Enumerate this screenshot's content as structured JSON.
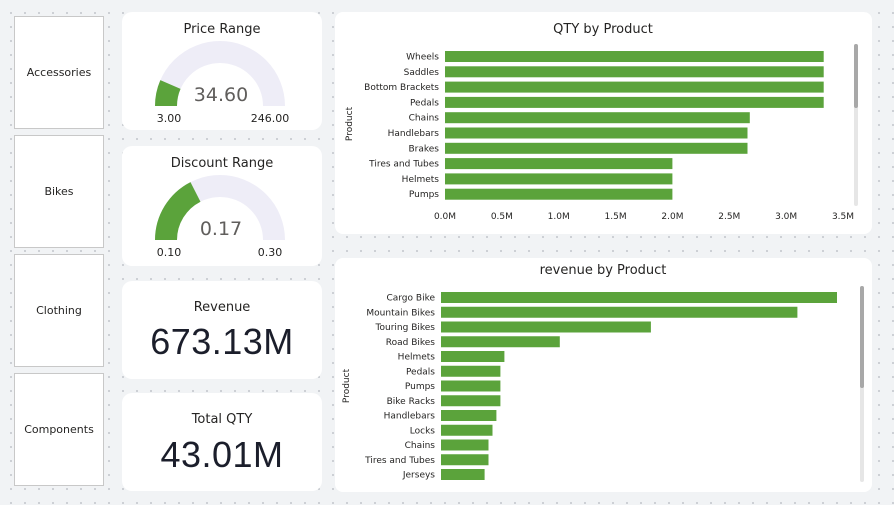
{
  "slicers": [
    {
      "label": "Accessories"
    },
    {
      "label": "Bikes"
    },
    {
      "label": "Clothing"
    },
    {
      "label": "Components"
    }
  ],
  "gauges": {
    "price": {
      "title": "Price Range",
      "value_label": "34.60",
      "min_label": "3.00",
      "max_label": "246.00",
      "value": 34.6,
      "min": 3.0,
      "max": 246.0
    },
    "discount": {
      "title": "Discount Range",
      "value_label": "0.17",
      "min_label": "0.10",
      "max_label": "0.30",
      "value": 0.17,
      "min": 0.1,
      "max": 0.3
    }
  },
  "kpis": {
    "revenue": {
      "title": "Revenue",
      "value": "673.13M"
    },
    "qty": {
      "title": "Total QTY",
      "value": "43.01M"
    }
  },
  "colors": {
    "bar": "#5ba33b",
    "gauge_track": "#eeedf7",
    "gauge_fill": "#5ba33b"
  },
  "chart_data": [
    {
      "type": "bar",
      "orientation": "horizontal",
      "title": "QTY by Product",
      "ylabel": "Product",
      "xlabel": "",
      "categories": [
        "Wheels",
        "Saddles",
        "Bottom Brackets",
        "Pedals",
        "Chains",
        "Handlebars",
        "Brakes",
        "Tires and Tubes",
        "Helmets",
        "Pumps"
      ],
      "values": [
        3.33,
        3.33,
        3.33,
        3.33,
        2.68,
        2.66,
        2.66,
        2.0,
        2.0,
        2.0
      ],
      "unit": "M",
      "xlim": [
        0,
        3.5
      ],
      "xticks": [
        "0.0M",
        "0.5M",
        "1.0M",
        "1.5M",
        "2.0M",
        "2.5M",
        "3.0M",
        "3.5M"
      ]
    },
    {
      "type": "bar",
      "orientation": "horizontal",
      "title": "revenue by Product",
      "ylabel": "Product",
      "xlabel": "",
      "categories": [
        "Cargo Bike",
        "Mountain Bikes",
        "Touring Bikes",
        "Road Bikes",
        "Helmets",
        "Pedals",
        "Pumps",
        "Bike Racks",
        "Handlebars",
        "Locks",
        "Chains",
        "Tires and Tubes",
        "Jerseys"
      ],
      "values": [
        100,
        90,
        53,
        30,
        16,
        15,
        15,
        15,
        14,
        13,
        12,
        12,
        11
      ],
      "xlim": [
        0,
        100
      ]
    }
  ]
}
